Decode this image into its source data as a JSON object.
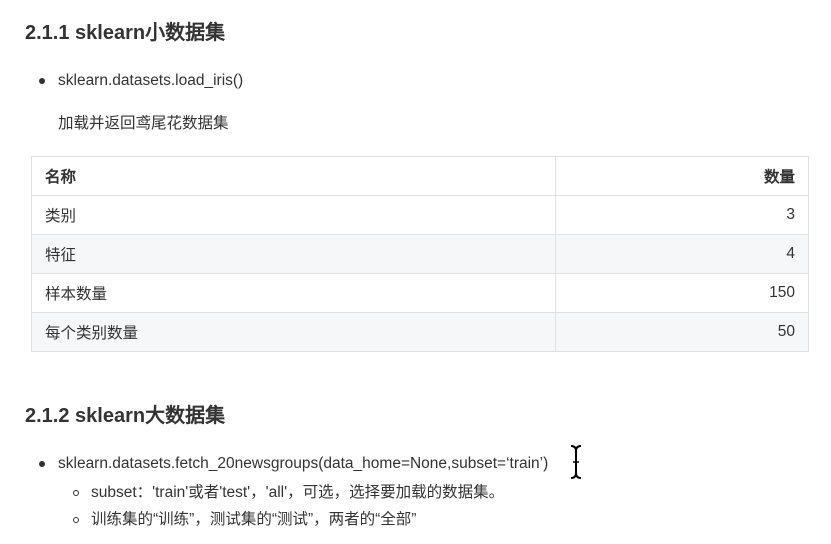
{
  "section_small": {
    "heading": "2.1.1 sklearn小数据集",
    "bullet": "sklearn.datasets.load_iris()",
    "description": "加载并返回鸢尾花数据集",
    "table": {
      "headers": [
        "名称",
        "数量"
      ],
      "rows": [
        [
          "类别",
          "3"
        ],
        [
          "特征",
          "4"
        ],
        [
          "样本数量",
          "150"
        ],
        [
          "每个类别数量",
          "50"
        ]
      ]
    }
  },
  "section_large": {
    "heading": "2.1.2 sklearn大数据集",
    "bullet": "sklearn.datasets.fetch_20newsgroups(data_home=None,subset=‘train’)",
    "sub_bullets": [
      "subset：'train'或者'test'，'all'，可选，选择要加载的数据集。",
      "训练集的“训练”，测试集的“测试”，两者的“全部”"
    ]
  },
  "icons": {
    "cursor": "text-cursor-icon"
  }
}
